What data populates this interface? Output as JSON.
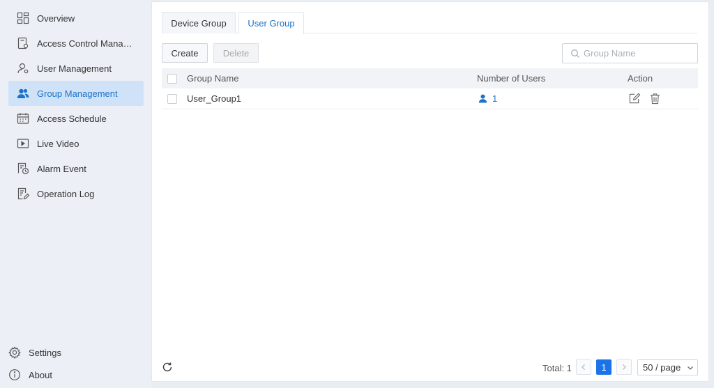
{
  "sidebar": {
    "items": [
      {
        "label": "Overview",
        "icon": "dashboard-grid-icon",
        "active": false
      },
      {
        "label": "Access Control Manag...",
        "icon": "access-device-icon",
        "active": false
      },
      {
        "label": "User Management",
        "icon": "user-icon",
        "active": false
      },
      {
        "label": "Group Management",
        "icon": "group-icon",
        "active": true
      },
      {
        "label": "Access Schedule",
        "icon": "calendar-icon",
        "active": false
      },
      {
        "label": "Live Video",
        "icon": "video-icon",
        "active": false
      },
      {
        "label": "Alarm Event",
        "icon": "alarm-clock-icon",
        "active": false
      },
      {
        "label": "Operation Log",
        "icon": "log-edit-icon",
        "active": false
      }
    ],
    "bottom": [
      {
        "label": "Settings",
        "icon": "gear-icon"
      },
      {
        "label": "About",
        "icon": "info-icon"
      }
    ]
  },
  "tabs": [
    {
      "label": "Device Group",
      "active": false
    },
    {
      "label": "User Group",
      "active": true
    }
  ],
  "toolbar": {
    "create_label": "Create",
    "delete_label": "Delete",
    "search_placeholder": "Group Name"
  },
  "table": {
    "headers": {
      "name": "Group Name",
      "users": "Number of Users",
      "action": "Action"
    },
    "rows": [
      {
        "name": "User_Group1",
        "users": "1"
      }
    ]
  },
  "pagination": {
    "total_label": "Total: 1",
    "current_page": "1",
    "page_size": "50 / page"
  },
  "colors": {
    "accent": "#1a73c9",
    "active_nav_bg": "#cfe2f8",
    "current_page_bg": "#1a73e8"
  }
}
